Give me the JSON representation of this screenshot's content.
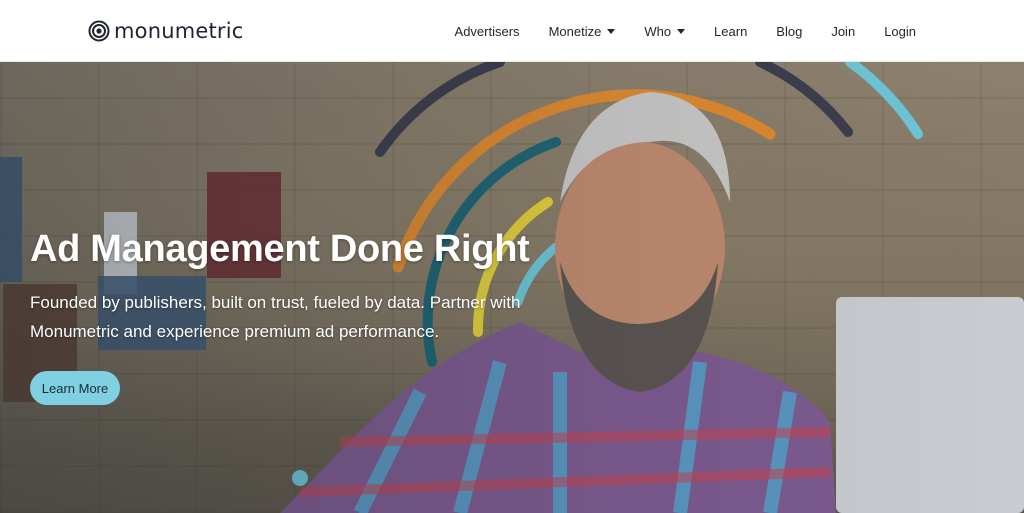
{
  "brand": {
    "name": "monumetric",
    "logo_icon": "concentric-circles-icon"
  },
  "nav": {
    "items": [
      {
        "label": "Advertisers",
        "dropdown": false
      },
      {
        "label": "Monetize",
        "dropdown": true
      },
      {
        "label": "Who",
        "dropdown": true
      },
      {
        "label": "Learn",
        "dropdown": false
      },
      {
        "label": "Blog",
        "dropdown": false
      },
      {
        "label": "Join",
        "dropdown": false
      },
      {
        "label": "Login",
        "dropdown": false
      }
    ]
  },
  "hero": {
    "title": "Ad Management Done Right",
    "subtitle": "Founded by publishers, built on trust, fueled by data. Partner with Monumetric and experience premium ad performance.",
    "cta_label": "Learn More"
  },
  "colors": {
    "arc_dark": "#3c3d4d",
    "arc_orange": "#e08a2e",
    "arc_teal": "#1e6474",
    "arc_yellow": "#e3cf3a",
    "arc_light_blue": "#6ec6d8",
    "cta_bg": "#7fd0e2"
  }
}
